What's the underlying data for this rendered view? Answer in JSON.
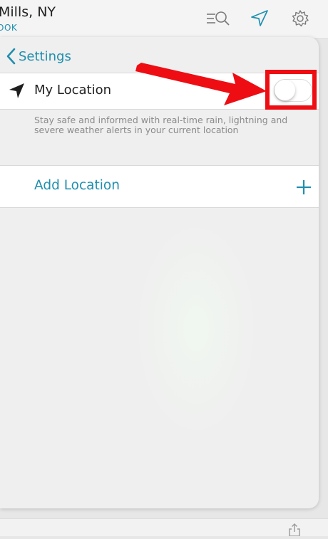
{
  "header": {
    "city": "Mills, NY",
    "sublink": "OOK",
    "icons": [
      "search-icon",
      "location-arrow-icon",
      "gear-icon"
    ]
  },
  "settings": {
    "back_label": "Settings",
    "my_location": {
      "label": "My Location",
      "toggle_on": false,
      "description": "Stay safe and informed with real-time rain, lightning and severe weather alerts in your current location"
    },
    "add_location_label": "Add Location"
  },
  "colors": {
    "accent": "#1f8fae",
    "annotation": "#ee0d13",
    "text": "#222222",
    "muted": "#8a8a8a"
  }
}
